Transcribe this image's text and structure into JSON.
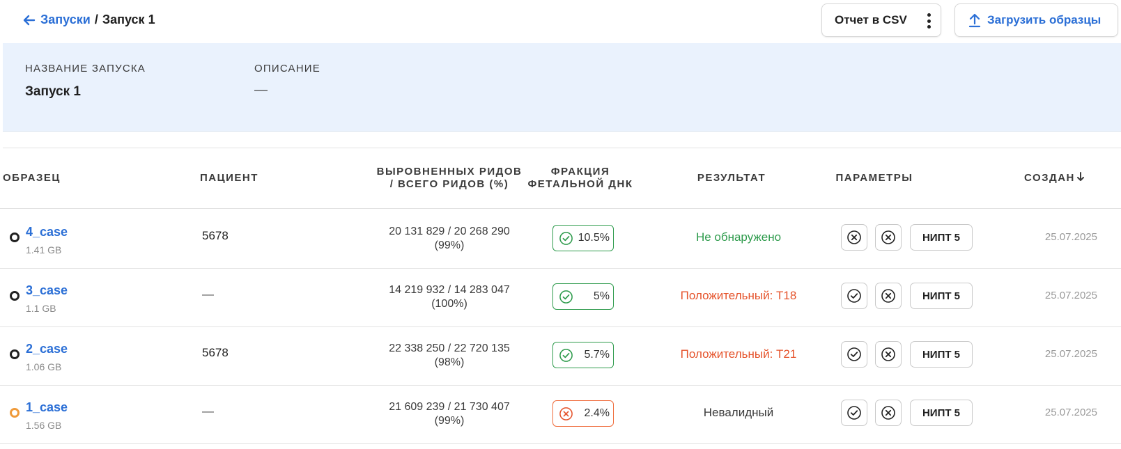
{
  "breadcrumb": {
    "parent": "Запуски",
    "separator": "/",
    "current": "Запуск 1"
  },
  "toolbar": {
    "csv_label": "Отчет в CSV",
    "upload_label": "Загрузить образцы"
  },
  "run_info": {
    "name_label": "НАЗВАНИЕ ЗАПУСКА",
    "name_value": "Запуск 1",
    "description_label": "ОПИСАНИЕ",
    "description_value": "—"
  },
  "table": {
    "headers": {
      "sample": "ОБРАЗЕЦ",
      "patient": "ПАЦИЕНТ",
      "reads_line1": "ВЫРОВНЕННЫХ РИДОВ",
      "reads_line2": "/ ВСЕГО РИДОВ (%)",
      "fraction_line1": "ФРАКЦИЯ",
      "fraction_line2": "ФЕТАЛЬНОЙ ДНК",
      "result": "РЕЗУЛЬТАТ",
      "params": "ПАРАМЕТРЫ",
      "created": "СОЗДАН"
    },
    "rows": [
      {
        "status": "ok",
        "sample": "4_case",
        "size": "1.41 GB",
        "patient": "5678",
        "reads_line1": "20 131 829 / 20 268 290",
        "reads_line2": "(99%)",
        "fraction": "10.5%",
        "fraction_ok": true,
        "result": "Не обнаружено",
        "result_color": "#2e9b4c",
        "param1_icon": "x-circle-icon",
        "param2_icon": "x-circle-icon",
        "nipt": "НИПТ 5",
        "created": "25.07.2025"
      },
      {
        "status": "ok",
        "sample": "3_case",
        "size": "1.1 GB",
        "patient": "—",
        "reads_line1": "14 219 932 / 14 283 047",
        "reads_line2": "(100%)",
        "fraction": "5%",
        "fraction_ok": true,
        "result": "Положительный: T18",
        "result_color": "#e5532b",
        "param1_icon": "check-circle-icon",
        "param2_icon": "x-circle-icon",
        "nipt": "НИПТ 5",
        "created": "25.07.2025"
      },
      {
        "status": "ok",
        "sample": "2_case",
        "size": "1.06 GB",
        "patient": "5678",
        "reads_line1": "22 338 250 / 22 720 135",
        "reads_line2": "(98%)",
        "fraction": "5.7%",
        "fraction_ok": true,
        "result": "Положительный: T21",
        "result_color": "#e5532b",
        "param1_icon": "check-circle-icon",
        "param2_icon": "x-circle-icon",
        "nipt": "НИПТ 5",
        "created": "25.07.2025"
      },
      {
        "status": "warning",
        "sample": "1_case",
        "size": "1.56 GB",
        "patient": "—",
        "reads_line1": "21 609 239 / 21 730 407",
        "reads_line2": "(99%)",
        "fraction": "2.4%",
        "fraction_ok": false,
        "result": "Невалидный",
        "result_color": "#3a3a3a",
        "param1_icon": "check-circle-icon",
        "param2_icon": "x-circle-icon",
        "nipt": "НИПТ 5",
        "created": "25.07.2025"
      }
    ]
  },
  "colors": {
    "accent": "#2b6fd6",
    "info_bg": "#eaf2fd",
    "ok": "#2e9b4c",
    "error": "#e5532b",
    "warning": "#ef9a3a"
  }
}
